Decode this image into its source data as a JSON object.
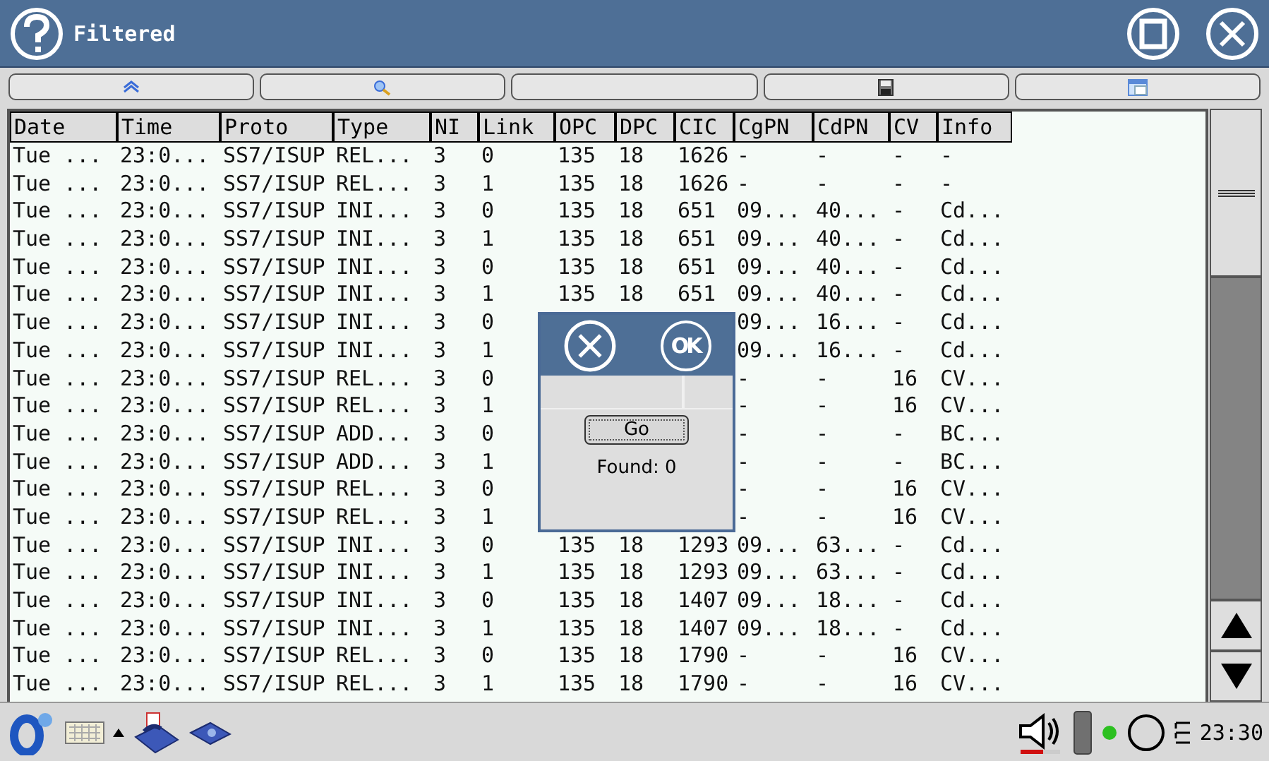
{
  "window": {
    "title": "Filtered"
  },
  "toolbar": [
    {
      "kind": "top"
    },
    {
      "kind": "find"
    },
    {
      "kind": "blank"
    },
    {
      "kind": "save"
    },
    {
      "kind": "window"
    }
  ],
  "table": {
    "columns": [
      "Date",
      "Time",
      "Proto",
      "Type",
      "NI",
      "Link",
      "OPC",
      "DPC",
      "CIC",
      "CgPN",
      "CdPN",
      "CV",
      "Info"
    ],
    "rows": [
      {
        "cells": [
          "Tue ...",
          "23:0...",
          "SS7/ISUP",
          "REL...",
          "3",
          "0",
          "135",
          "18",
          "1626",
          "-",
          "-",
          "-",
          "-"
        ]
      },
      {
        "cells": [
          "Tue ...",
          "23:0...",
          "SS7/ISUP",
          "REL...",
          "3",
          "1",
          "135",
          "18",
          "1626",
          "-",
          "-",
          "-",
          "-"
        ]
      },
      {
        "cells": [
          "Tue ...",
          "23:0...",
          "SS7/ISUP",
          "INI...",
          "3",
          "0",
          "135",
          "18",
          "651",
          "09...",
          "40...",
          "-",
          "Cd..."
        ]
      },
      {
        "cells": [
          "Tue ...",
          "23:0...",
          "SS7/ISUP",
          "INI...",
          "3",
          "1",
          "135",
          "18",
          "651",
          "09...",
          "40...",
          "-",
          "Cd..."
        ]
      },
      {
        "cells": [
          "Tue ...",
          "23:0...",
          "SS7/ISUP",
          "INI...",
          "3",
          "0",
          "135",
          "18",
          "651",
          "09...",
          "40...",
          "-",
          "Cd..."
        ]
      },
      {
        "cells": [
          "Tue ...",
          "23:0...",
          "SS7/ISUP",
          "INI...",
          "3",
          "1",
          "135",
          "18",
          "651",
          "09...",
          "40...",
          "-",
          "Cd..."
        ]
      },
      {
        "cells": [
          "Tue ...",
          "23:0...",
          "SS7/ISUP",
          "INI...",
          "3",
          "0",
          null,
          null,
          null,
          "09...",
          "16...",
          "-",
          "Cd..."
        ]
      },
      {
        "cells": [
          "Tue ...",
          "23:0...",
          "SS7/ISUP",
          "INI...",
          "3",
          "1",
          null,
          null,
          null,
          "09...",
          "16...",
          "-",
          "Cd..."
        ]
      },
      {
        "cells": [
          "Tue ...",
          "23:0...",
          "SS7/ISUP",
          "REL...",
          "3",
          "0",
          null,
          null,
          null,
          "-",
          "-",
          "16",
          "CV..."
        ]
      },
      {
        "cells": [
          "Tue ...",
          "23:0...",
          "SS7/ISUP",
          "REL...",
          "3",
          "1",
          null,
          null,
          null,
          "-",
          "-",
          "16",
          "CV..."
        ]
      },
      {
        "cells": [
          "Tue ...",
          "23:0...",
          "SS7/ISUP",
          "ADD...",
          "3",
          "0",
          null,
          null,
          null,
          "-",
          "-",
          "-",
          "BC..."
        ]
      },
      {
        "cells": [
          "Tue ...",
          "23:0...",
          "SS7/ISUP",
          "ADD...",
          "3",
          "1",
          null,
          null,
          null,
          "-",
          "-",
          "-",
          "BC..."
        ]
      },
      {
        "cells": [
          "Tue ...",
          "23:0...",
          "SS7/ISUP",
          "REL...",
          "3",
          "0",
          null,
          null,
          null,
          "-",
          "-",
          "16",
          "CV..."
        ]
      },
      {
        "cells": [
          "Tue ...",
          "23:0...",
          "SS7/ISUP",
          "REL...",
          "3",
          "1",
          null,
          null,
          null,
          "-",
          "-",
          "16",
          "CV..."
        ]
      },
      {
        "cells": [
          "Tue ...",
          "23:0...",
          "SS7/ISUP",
          "INI...",
          "3",
          "0",
          "135",
          "18",
          "1293",
          "09...",
          "63...",
          "-",
          "Cd..."
        ]
      },
      {
        "cells": [
          "Tue ...",
          "23:0...",
          "SS7/ISUP",
          "INI...",
          "3",
          "1",
          "135",
          "18",
          "1293",
          "09...",
          "63...",
          "-",
          "Cd..."
        ]
      },
      {
        "cells": [
          "Tue ...",
          "23:0...",
          "SS7/ISUP",
          "INI...",
          "3",
          "0",
          "135",
          "18",
          "1407",
          "09...",
          "18...",
          "-",
          "Cd..."
        ]
      },
      {
        "cells": [
          "Tue ...",
          "23:0...",
          "SS7/ISUP",
          "INI...",
          "3",
          "1",
          "135",
          "18",
          "1407",
          "09...",
          "18...",
          "-",
          "Cd..."
        ]
      },
      {
        "cells": [
          "Tue ...",
          "23:0...",
          "SS7/ISUP",
          "REL...",
          "3",
          "0",
          "135",
          "18",
          "1790",
          "-",
          "-",
          "16",
          "CV..."
        ]
      },
      {
        "cells": [
          "Tue ...",
          "23:0...",
          "SS7/ISUP",
          "REL...",
          "3",
          "1",
          "135",
          "18",
          "1790",
          "-",
          "-",
          "16",
          "CV..."
        ]
      }
    ]
  },
  "dialog": {
    "ok_label": "OK",
    "go_button": "Go",
    "found": "Found: 0"
  },
  "taskbar": {
    "clock": "23:30"
  }
}
